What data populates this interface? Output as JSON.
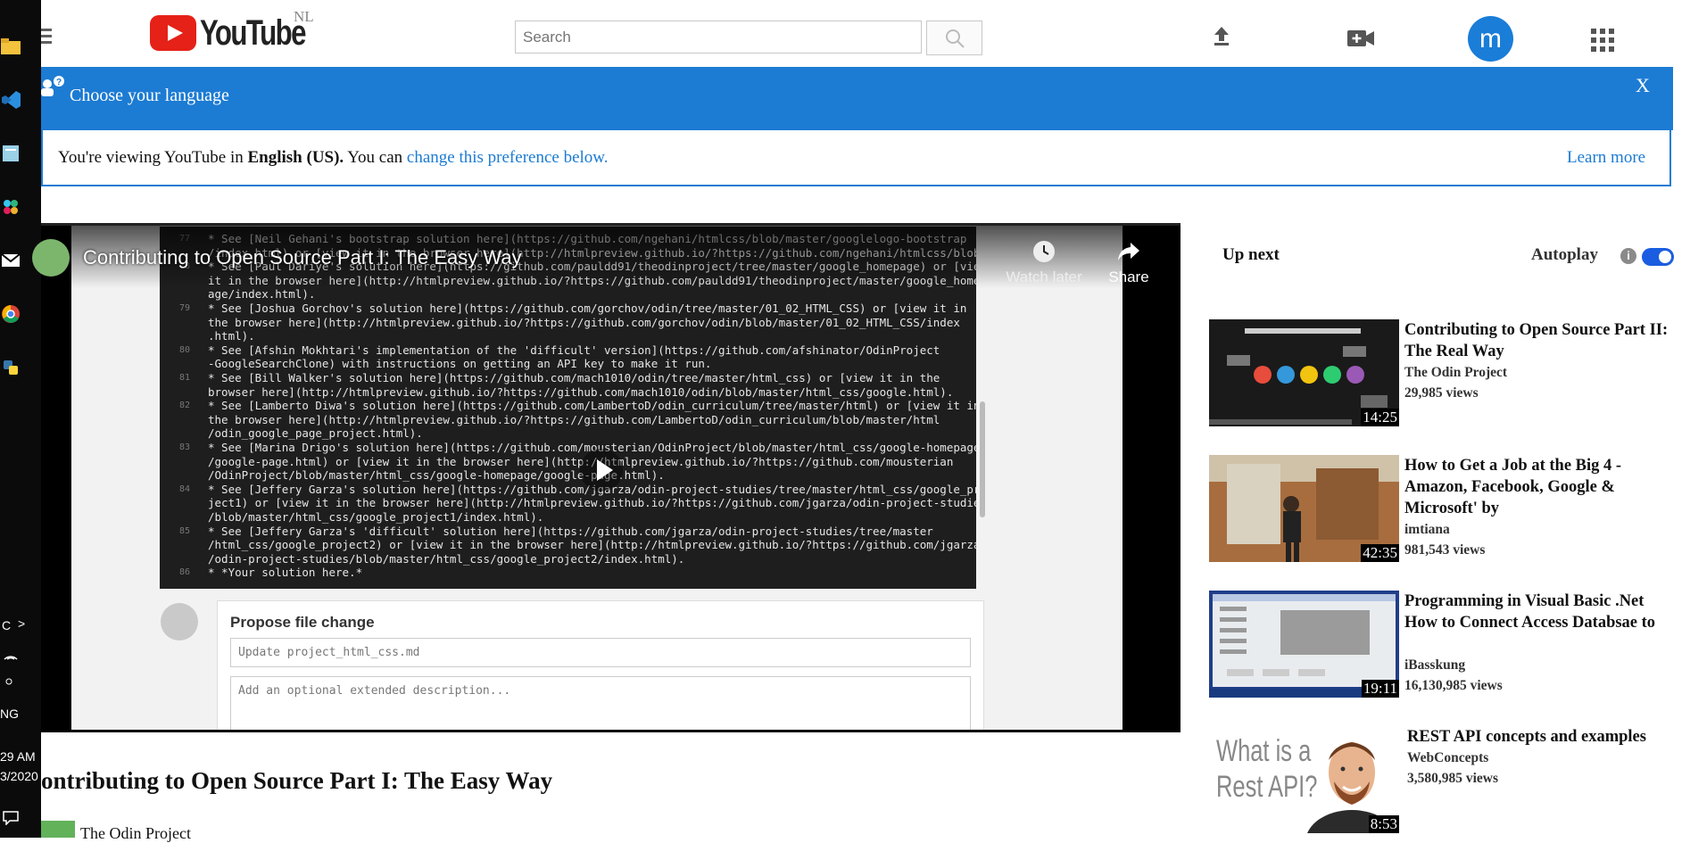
{
  "taskbar": {
    "chevron": ">",
    "language": "NG",
    "time": "29 AM",
    "date": "3/2020"
  },
  "header": {
    "logo_text": "YouTube",
    "region": "NL",
    "search_placeholder": "Search",
    "avatar_letter": "m",
    "icons": [
      "menu-icon",
      "search-icon",
      "upload-icon",
      "create-video-icon",
      "apps-grid-icon"
    ]
  },
  "language_banner": {
    "title": "Choose your language",
    "close": "X",
    "text_prefix": "You're viewing YouTube in ",
    "language": "English (US).",
    "text_middle": " You can ",
    "link": "change this preference below.",
    "learn_more": "Learn more"
  },
  "player": {
    "title": "Contributing to Open Source Part I: The Easy Way",
    "watch_later": "Watch later",
    "share": "Share",
    "code_lines": [
      {
        "num": "77",
        "text": "* See [Neil Gehani's bootstrap solution here](https://github.com/ngehani/htmlcss/blob/master/googlelogo-bootstrap"
      },
      {
        "num": "",
        "text": "/index.html) or [view it in the browser here](http://htmlpreview.github.io/?https://github.com/ngehani/htmlcss/blob"
      },
      {
        "num": "78",
        "text": "* See [Paul Dariye's solution here](https://github.com/pauldd91/theodinproject/tree/master/google_homepage) or [view"
      },
      {
        "num": "",
        "text": "it in the browser here](http://htmlpreview.github.io/?https://github.com/pauldd91/theodinproject/master/google_homep"
      },
      {
        "num": "",
        "text": "age/index.html)."
      },
      {
        "num": "79",
        "text": "* See [Joshua Gorchov's solution here](https://github.com/gorchov/odin/tree/master/01_02_HTML_CSS) or [view it in"
      },
      {
        "num": "",
        "text": "the browser here](http://htmlpreview.github.io/?https://github.com/gorchov/odin/blob/master/01_02_HTML_CSS/index"
      },
      {
        "num": "",
        "text": ".html)."
      },
      {
        "num": "80",
        "text": "* See [Afshin Mokhtari's implementation of the 'difficult' version](https://github.com/afshinator/OdinProject"
      },
      {
        "num": "",
        "text": "-GoogleSearchClone) with instructions on getting an API key to make it run."
      },
      {
        "num": "81",
        "text": "* See [Bill Walker's solution here](https://github.com/mach1010/odin/tree/master/html_css) or [view it in the"
      },
      {
        "num": "",
        "text": "browser here](http://htmlpreview.github.io/?https://github.com/mach1010/odin/blob/master/html_css/google.html)."
      },
      {
        "num": "82",
        "text": "* See [Lamberto Diwa's solution here](https://github.com/LambertoD/odin_curriculum/tree/master/html) or [view it in"
      },
      {
        "num": "",
        "text": "the browser here](http://htmlpreview.github.io/?https://github.com/LambertoD/odin_curriculum/blob/master/html"
      },
      {
        "num": "",
        "text": "/odin_google_page_project.html)."
      },
      {
        "num": "83",
        "text": "* See [Marina Drigo's solution here](https://github.com/mousterian/OdinProject/blob/master/html_css/google-homepage"
      },
      {
        "num": "",
        "text": "/google-page.html) or [view it in the browser here](http://htmlpreview.github.io/?https://github.com/mousterian"
      },
      {
        "num": "",
        "text": "/OdinProject/blob/master/html_css/google-homepage/google-page.html)."
      },
      {
        "num": "84",
        "text": "* See [Jeffery Garza's solution here](https://github.com/jgarza/odin-project-studies/tree/master/html_css/google_pro"
      },
      {
        "num": "",
        "text": "ject1) or [view it in the browser here](http://htmlpreview.github.io/?https://github.com/jgarza/odin-project-studies"
      },
      {
        "num": "",
        "text": "/blob/master/html_css/google_project1/index.html)."
      },
      {
        "num": "85",
        "text": "* See [Jeffery Garza's 'difficult' solution here](https://github.com/jgarza/odin-project-studies/tree/master"
      },
      {
        "num": "",
        "text": "/html_css/google_project2) or [view it in the browser here](http://htmlpreview.github.io/?https://github.com/jgarza"
      },
      {
        "num": "",
        "text": "/odin-project-studies/blob/master/html_css/google_project2/index.html)."
      },
      {
        "num": "86",
        "text": "* *Your solution here.*"
      }
    ],
    "propose_title": "Propose file change",
    "propose_placeholder": "Update project_html_css.md",
    "description_placeholder": "Add an optional extended description..."
  },
  "video": {
    "title": "ontributing to Open Source Part I: The Easy Way",
    "channel": "The Odin Project"
  },
  "sidebar": {
    "up_next": "Up next",
    "autoplay": "Autoplay",
    "autoplay_on": true,
    "recommendations": [
      {
        "title": "Contributing to Open Source Part II: The Real Way",
        "channel": "The Odin Project",
        "views": "29,985 views",
        "duration": "14:25",
        "thumb": "dark-diagram"
      },
      {
        "title": "How to Get a Job at the Big 4 - Amazon, Facebook, Google & Microsoft' by",
        "channel": "imtiana",
        "views": "981,543 views",
        "duration": "42:35",
        "thumb": "lecture"
      },
      {
        "title": "Programming in Visual Basic .Net How to Connect Access Databsae to",
        "channel": "iBasskung",
        "views": "16,130,985 views",
        "duration": "19:11",
        "thumb": "windows-form"
      },
      {
        "title": "REST API concepts and examples",
        "channel": "WebConcepts",
        "views": "3,580,985 views",
        "duration": "8:53",
        "thumb": "rest-api",
        "thumb_text_1": "What is a",
        "thumb_text_2": "Rest API?"
      }
    ]
  }
}
